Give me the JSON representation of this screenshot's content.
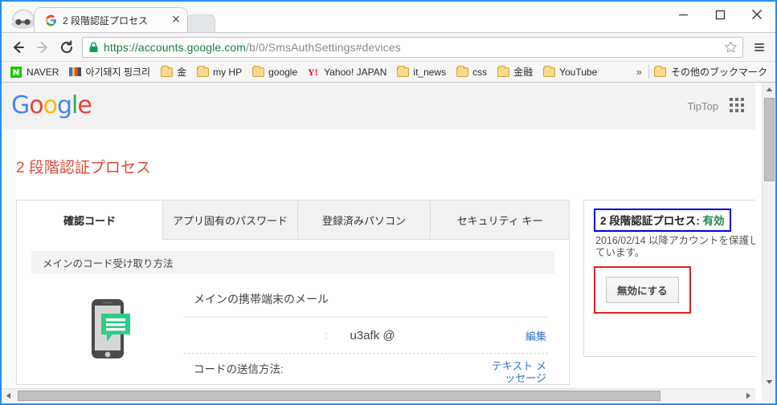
{
  "window": {
    "controls": {
      "minimize": "minimize-button",
      "maximize": "maximize-button",
      "close": "close-button"
    }
  },
  "browser": {
    "incognito_icon": "incognito-icon",
    "tab": {
      "favicon": "google-favicon",
      "title": "2 段階認証プロセス",
      "close_label": "✕"
    },
    "new_tab_stub": "new-tab-button",
    "nav": {
      "back": "back-arrow-icon",
      "forward": "forward-arrow-icon",
      "reload": "reload-icon"
    },
    "omnibox": {
      "lock_icon": "lock-icon",
      "url_secure": "https://accounts.google.com",
      "url_rest": "/b/0/SmsAuthSettings#devices",
      "full_url": "https://accounts.google.com/b/0/SmsAuthSettings#devices",
      "star_icon": "star-icon"
    },
    "menu_icon": "hamburger-menu-icon",
    "bookmarks": [
      {
        "label": "NAVER",
        "icon": "naver-icon"
      },
      {
        "label": "아기돼지 핑크리",
        "icon": "striped-icon"
      },
      {
        "label": "金",
        "icon": "folder-icon"
      },
      {
        "label": "my HP",
        "icon": "folder-icon"
      },
      {
        "label": "google",
        "icon": "folder-icon"
      },
      {
        "label": "Yahoo! JAPAN",
        "icon": "yahoo-icon"
      },
      {
        "label": "it_news",
        "icon": "folder-icon"
      },
      {
        "label": "css",
        "icon": "folder-icon"
      },
      {
        "label": "金融",
        "icon": "folder-icon"
      },
      {
        "label": "YouTube",
        "icon": "folder-icon"
      }
    ],
    "bookmarks_overflow": "»",
    "other_bookmarks": {
      "label": "その他のブックマーク",
      "icon": "folder-icon"
    }
  },
  "page": {
    "logo": {
      "letters": [
        {
          "char": "G",
          "color": "#4285f4"
        },
        {
          "char": "o",
          "color": "#ea4335"
        },
        {
          "char": "o",
          "color": "#fbbc05"
        },
        {
          "char": "g",
          "color": "#4285f4"
        },
        {
          "char": "l",
          "color": "#34a853"
        },
        {
          "char": "e",
          "color": "#ea4335"
        }
      ]
    },
    "user_label": "TipTop",
    "apps_icon": "apps-grid-icon",
    "title": "2 段階認証プロセス",
    "tabs": [
      {
        "label": "確認コード",
        "active": true
      },
      {
        "label": "アプリ固有のパスワード",
        "active": false
      },
      {
        "label": "登録済みパソコン",
        "active": false
      },
      {
        "label": "セキュリティ キー",
        "active": false
      }
    ],
    "section_header": "メインのコード受け取り方法",
    "method": {
      "phone_icon": "phone-with-message-icon",
      "title": "メインの携帯端末のメール",
      "email_row": {
        "prefix": ":",
        "value": "u3afk @",
        "edit_link": "編集"
      },
      "send_row": {
        "label": "コードの送信方法:",
        "link": "テキスト メッセージ"
      }
    },
    "side_panel": {
      "status_label": "2 段階認証プロセス:",
      "status_value": "有効",
      "status_description": "2016/02/14 以降アカウントを保護しています。",
      "disable_button": "無効にする"
    }
  },
  "scrollbars": {
    "vertical": {
      "up": "scroll-up-arrow",
      "down": "scroll-down-arrow"
    },
    "horizontal": {
      "left": "scroll-left-arrow",
      "right": "scroll-right-arrow"
    }
  },
  "colors": {
    "accent_blue": "#2a8ceb",
    "google_red": "#dd4b39",
    "status_green": "#1a8a4b",
    "annotation_blue": "#0000e6",
    "annotation_red": "#e02020",
    "link_blue": "#2f6fd0"
  }
}
